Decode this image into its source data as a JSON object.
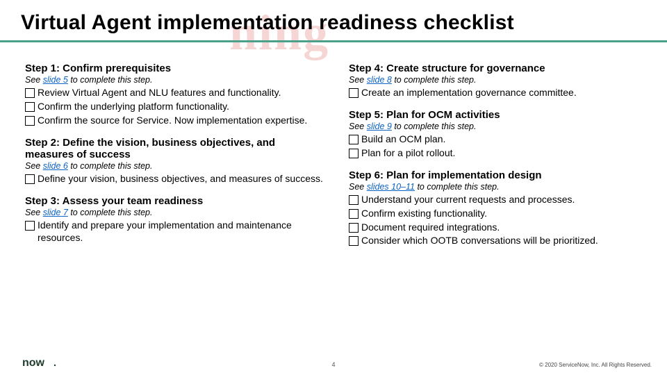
{
  "title": "Virtual Agent implementation readiness checklist",
  "watermark": "ning",
  "steps": {
    "s1": {
      "heading": "Step 1: Confirm prerequisites",
      "see_pre": "See ",
      "see_link": "slide 5",
      "see_post": " to complete this step.",
      "items": [
        "Review Virtual Agent and NLU features and functionality.",
        "Confirm the underlying platform functionality.",
        "Confirm the source for Service. Now implementation expertise."
      ]
    },
    "s2": {
      "heading": "Step 2: Define the vision, business objectives, and measures of success",
      "see_pre": "See ",
      "see_link": "slide 6",
      "see_post": " to complete this step.",
      "items": [
        "Define your vision, business objectives, and measures of success."
      ]
    },
    "s3": {
      "heading": "Step 3: Assess your team readiness",
      "see_pre": "See ",
      "see_link": "slide 7",
      "see_post": " to complete this step.",
      "items": [
        "Identify and prepare your implementation and maintenance resources."
      ]
    },
    "s4": {
      "heading": "Step 4: Create structure for governance",
      "see_pre": "See ",
      "see_link": "slide 8",
      "see_post": " to complete this step.",
      "items": [
        "Create an implementation governance committee."
      ]
    },
    "s5": {
      "heading": "Step 5: Plan for OCM activities",
      "see_pre": "See ",
      "see_link": "slide 9",
      "see_post": " to complete this step.",
      "items": [
        "Build an OCM plan.",
        "Plan for a pilot rollout."
      ]
    },
    "s6": {
      "heading": "Step 6: Plan for implementation design",
      "see_pre": "See ",
      "see_link": "slides 10–11",
      "see_post": " to complete this step.",
      "items": [
        "Understand your current requests and processes.",
        "Confirm existing functionality.",
        "Document required integrations.",
        "Consider which OOTB conversations will be prioritized."
      ]
    }
  },
  "page_number": "4",
  "copyright": "© 2020 ServiceNow, Inc. All Rights Reserved.",
  "logo_text": "now"
}
